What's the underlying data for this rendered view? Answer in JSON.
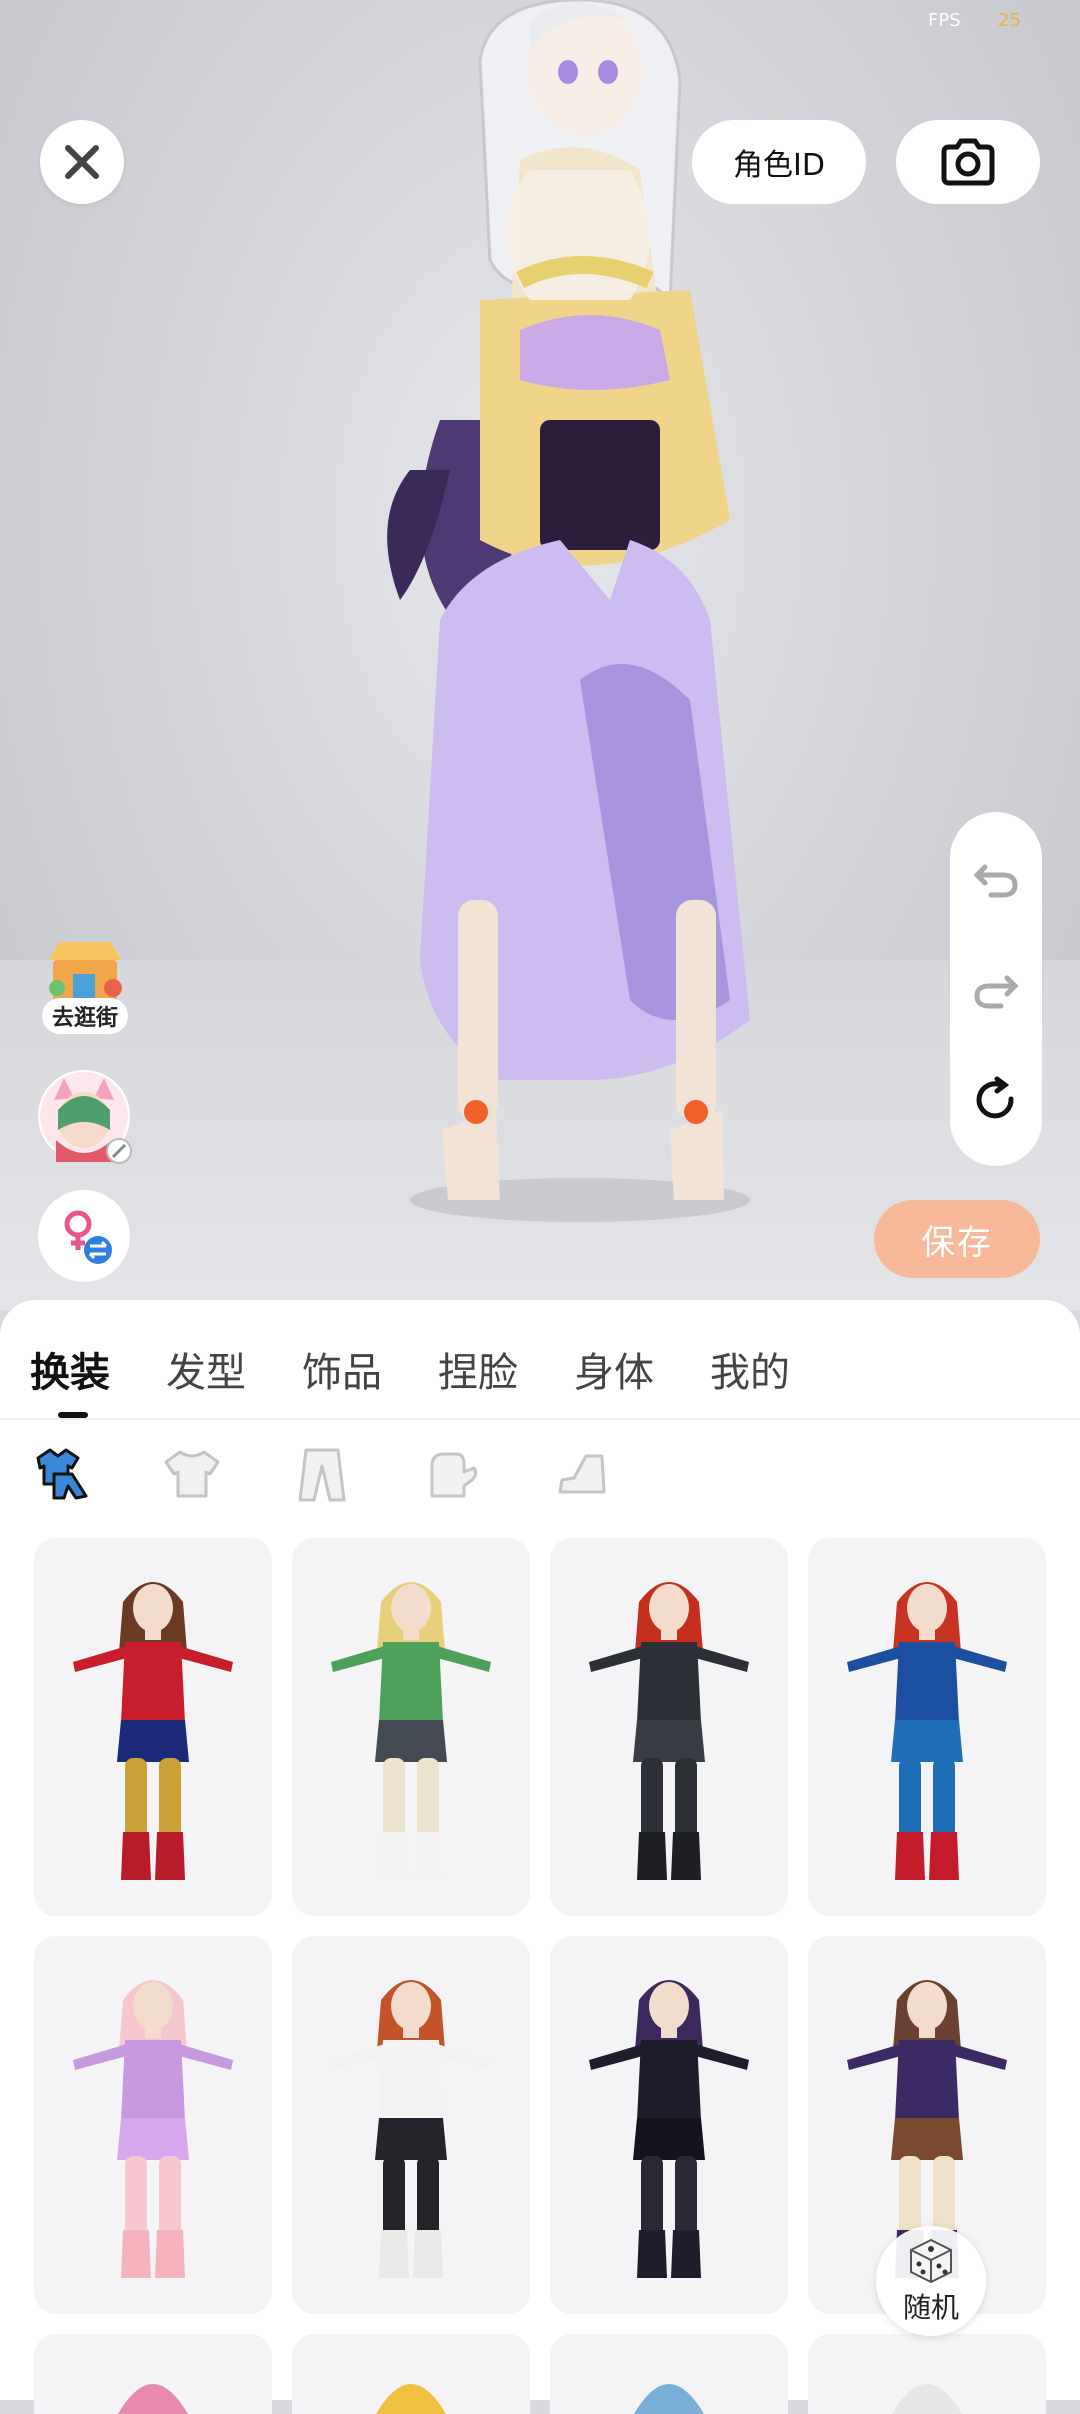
{
  "status": {
    "fps_label": "FPS",
    "fps_value": "25"
  },
  "top_bar": {
    "role_id_label": "角色ID"
  },
  "left_actions": {
    "shop_label": "去逛街"
  },
  "right_actions": {
    "save_label": "保存"
  },
  "sheet": {
    "tabs": [
      "换装",
      "发型",
      "饰品",
      "捏脸",
      "身体",
      "我的"
    ],
    "active_tab": "换装",
    "subcategories": [
      "set-icon",
      "top-icon",
      "pants-icon",
      "gloves-icon",
      "shoes-icon"
    ],
    "random_label": "随机"
  },
  "outfits": [
    {
      "name": "wonder-hero",
      "hair": "#6b3a22",
      "top": "#c81e2c",
      "bottom": "#1c2a7a",
      "legs": "#c8a237",
      "boots": "#b81c2a"
    },
    {
      "name": "green-ninja",
      "hair": "#e8cf7a",
      "top": "#4fa05a",
      "bottom": "#444a52",
      "legs": "#ece3cf",
      "boots": "#f3f3f3"
    },
    {
      "name": "black-spy",
      "hair": "#c42f1e",
      "top": "#2d2f36",
      "bottom": "#3a3c44",
      "legs": "#2d2f36",
      "boots": "#1f2024"
    },
    {
      "name": "captain-suit",
      "hair": "#c93322",
      "top": "#1c4fa0",
      "bottom": "#1e6fb8",
      "legs": "#1e6fb8",
      "boots": "#c31d2c"
    },
    {
      "name": "pink-cat",
      "hair": "#f7c7cf",
      "top": "#c79ae0",
      "bottom": "#d7a6ec",
      "legs": "#f7c7cf",
      "boots": "#f5b3be"
    },
    {
      "name": "casual-sport",
      "hair": "#c3532a",
      "top": "#f2f2f2",
      "bottom": "#23252b",
      "legs": "#23252b",
      "boots": "#e9e9e9"
    },
    {
      "name": "gothic-dress",
      "hair": "#3c2a5e",
      "top": "#1f1d2c",
      "bottom": "#15141e",
      "legs": "#2b2935",
      "boots": "#1f1d2c"
    },
    {
      "name": "academy-coat",
      "hair": "#6a4030",
      "top": "#3b2a63",
      "bottom": "#7a4a2e",
      "legs": "#efe0c8",
      "boots": "#3b2a63"
    }
  ],
  "partial_row_hair": [
    "#e88ab0",
    "#f0c040",
    "#7ab0d8",
    "#e6e6e6"
  ]
}
